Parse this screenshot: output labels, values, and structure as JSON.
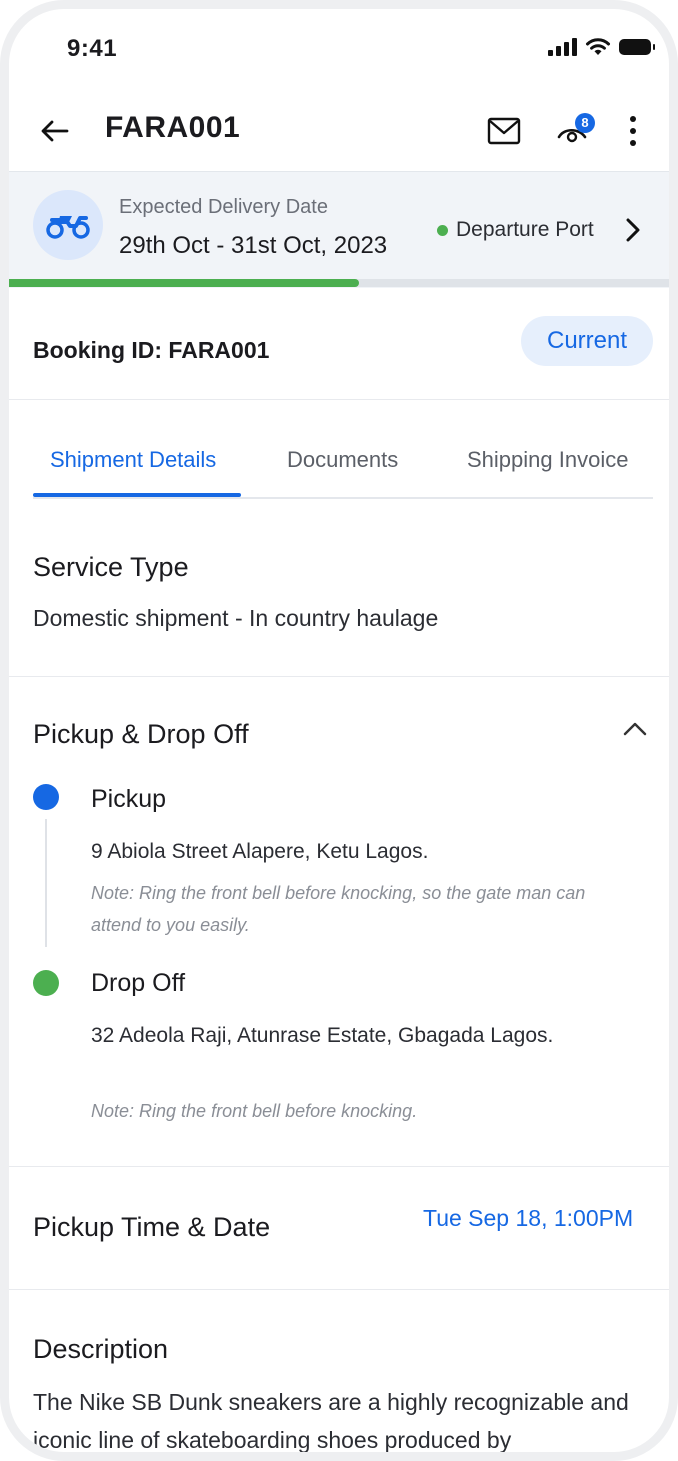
{
  "status_bar": {
    "time": "9:41"
  },
  "header": {
    "title": "FARA001",
    "notification_count": "8"
  },
  "delivery_banner": {
    "label": "Expected Delivery Date",
    "date_range": "29th Oct - 31st Oct, 2023",
    "status": "Departure Port",
    "status_color": "#4caf50",
    "progress_fraction": 0.53
  },
  "booking": {
    "id_text": "Booking ID: FARA001",
    "status_badge": "Current"
  },
  "tabs": [
    {
      "label": "Shipment Details",
      "active": true
    },
    {
      "label": "Documents",
      "active": false
    },
    {
      "label": "Shipping Invoice",
      "active": false
    }
  ],
  "service": {
    "title": "Service Type",
    "value": "Domestic shipment - In country haulage"
  },
  "pickup_dropoff": {
    "title": "Pickup & Drop Off",
    "pickup": {
      "label": "Pickup",
      "address": "9 Abiola Street Alapere, Ketu Lagos.",
      "note": "Note: Ring the front bell before knocking, so the gate man can attend to you easily.",
      "dot_color": "#1668e3"
    },
    "dropoff": {
      "label": "Drop Off",
      "address": "32 Adeola Raji, Atunrase Estate, Gbagada Lagos.",
      "note": "Note: Ring the front bell before knocking.",
      "dot_color": "#4caf50"
    }
  },
  "pickup_time": {
    "title": "Pickup Time & Date",
    "value": "Tue Sep 18, 1:00PM"
  },
  "description": {
    "title": "Description",
    "text": "The Nike SB Dunk sneakers are a highly recognizable and iconic line of skateboarding shoes produced by"
  },
  "colors": {
    "accent": "#1668e3",
    "success": "#4caf50",
    "banner_bg": "#f1f4f8"
  }
}
